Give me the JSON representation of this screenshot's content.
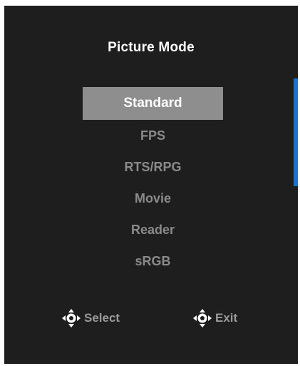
{
  "osd": {
    "title": "Picture Mode",
    "items": [
      {
        "label": "Standard",
        "selected": true
      },
      {
        "label": "FPS",
        "selected": false
      },
      {
        "label": "RTS/RPG",
        "selected": false
      },
      {
        "label": "Movie",
        "selected": false
      },
      {
        "label": "Reader",
        "selected": false
      },
      {
        "label": "sRGB",
        "selected": false
      }
    ],
    "footer": {
      "select_label": "Select",
      "exit_label": "Exit",
      "select_icon": "joystick-icon",
      "exit_icon": "joystick-icon"
    },
    "colors": {
      "background": "#1e1e1e",
      "highlight": "#8e8e8e",
      "scrollbar": "#1a74c9",
      "inactive_text": "#8a8a8a"
    }
  }
}
